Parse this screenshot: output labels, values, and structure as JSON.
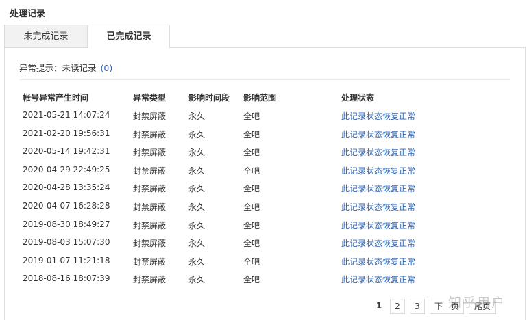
{
  "page": {
    "title": "处理记录"
  },
  "tabs": [
    {
      "label": "未完成记录",
      "active": false
    },
    {
      "label": "已完成记录",
      "active": true
    }
  ],
  "notice": {
    "label": "异常提示：未读记录",
    "count": "(0)"
  },
  "table": {
    "headers": [
      "帐号异常产生时间",
      "异常类型",
      "影响时间段",
      "影响范围",
      "处理状态"
    ],
    "rows": [
      [
        "2021-05-21 14:07:24",
        "封禁屏蔽",
        "永久",
        "全吧",
        "此记录状态恢复正常"
      ],
      [
        "2021-02-20 19:56:31",
        "封禁屏蔽",
        "永久",
        "全吧",
        "此记录状态恢复正常"
      ],
      [
        "2020-05-14 19:42:31",
        "封禁屏蔽",
        "永久",
        "全吧",
        "此记录状态恢复正常"
      ],
      [
        "2020-04-29 22:49:25",
        "封禁屏蔽",
        "永久",
        "全吧",
        "此记录状态恢复正常"
      ],
      [
        "2020-04-28 13:35:24",
        "封禁屏蔽",
        "永久",
        "全吧",
        "此记录状态恢复正常"
      ],
      [
        "2020-04-07 16:28:28",
        "封禁屏蔽",
        "永久",
        "全吧",
        "此记录状态恢复正常"
      ],
      [
        "2019-08-30 18:49:27",
        "封禁屏蔽",
        "永久",
        "全吧",
        "此记录状态恢复正常"
      ],
      [
        "2019-08-03 15:07:30",
        "封禁屏蔽",
        "永久",
        "全吧",
        "此记录状态恢复正常"
      ],
      [
        "2019-01-07 11:21:18",
        "封禁屏蔽",
        "永久",
        "全吧",
        "此记录状态恢复正常"
      ],
      [
        "2018-08-16 18:07:39",
        "封禁屏蔽",
        "永久",
        "全吧",
        "此记录状态恢复正常"
      ]
    ]
  },
  "pagination": {
    "pages": [
      "1",
      "2",
      "3"
    ],
    "current": "1",
    "next_label": "下一页",
    "last_label": "尾页"
  },
  "watermark": "知乎用户",
  "colors": {
    "link": "#2d64b3",
    "border": "#dddddd",
    "inactive_tab": "#f2f2f2"
  }
}
